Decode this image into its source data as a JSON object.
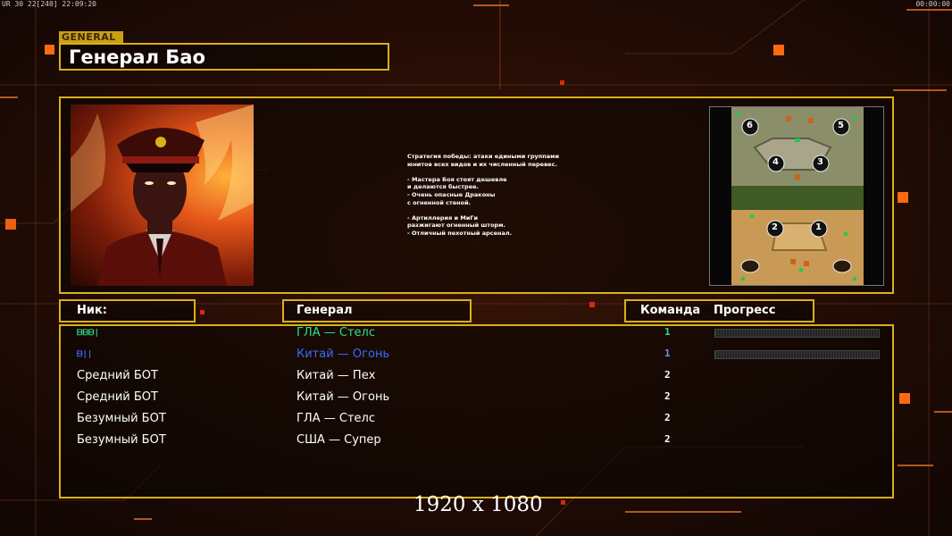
{
  "hud": {
    "left": "UR 30 22[240] 22:09:20",
    "right": "00:00:00"
  },
  "general_tag": "GENERAL",
  "general_name": "Генерал Бао",
  "description": "Стратегия победы: атаки едиными группами\nюнитов всех видов и их численный перевес.\n\n- Мастера Боя стоят дешевле\nи делаются быстрее.\n- Очень опасные Драконы\nс огненной стеной.\n\n- Артиллерия и МиГи\nразжигают огненный шторм.\n- Отличный пехотный арсенал.",
  "columns": {
    "nick": "Ник:",
    "general": "Генерал",
    "team": "Команда",
    "progress": "Прогресс"
  },
  "players": [
    {
      "name": "ᗷᗷᗷ|",
      "general": "ГЛА — Стелс",
      "team": "1",
      "name_color": "#2be08a",
      "general_color": "#2be08a",
      "team_color": "#2be08a",
      "progress": 0
    },
    {
      "name": "ᗷ||",
      "general": "Китай — Огонь",
      "team": "1",
      "name_color": "#3a6bff",
      "general_color": "#3a6bff",
      "team_color": "#6f8dff",
      "progress": 0
    },
    {
      "name": "Средний БОТ",
      "general": "Китай — Пех",
      "team": "2",
      "name_color": "#ffffff",
      "general_color": "#ffffff",
      "team_color": "#ffffff"
    },
    {
      "name": "Средний БОТ",
      "general": "Китай — Огонь",
      "team": "2",
      "name_color": "#ffffff",
      "general_color": "#ffffff",
      "team_color": "#ffffff"
    },
    {
      "name": "Безумный БОТ",
      "general": "ГЛА — Стелс",
      "team": "2",
      "name_color": "#ffffff",
      "general_color": "#ffffff",
      "team_color": "#ffffff"
    },
    {
      "name": "Безумный БОТ",
      "general": "США — Супер",
      "team": "2",
      "name_color": "#ffffff",
      "general_color": "#ffffff",
      "team_color": "#ffffff"
    }
  ],
  "map_slots": [
    "6",
    "5",
    "4",
    "3",
    "2",
    "1"
  ],
  "watermark": "1920 x 1080"
}
